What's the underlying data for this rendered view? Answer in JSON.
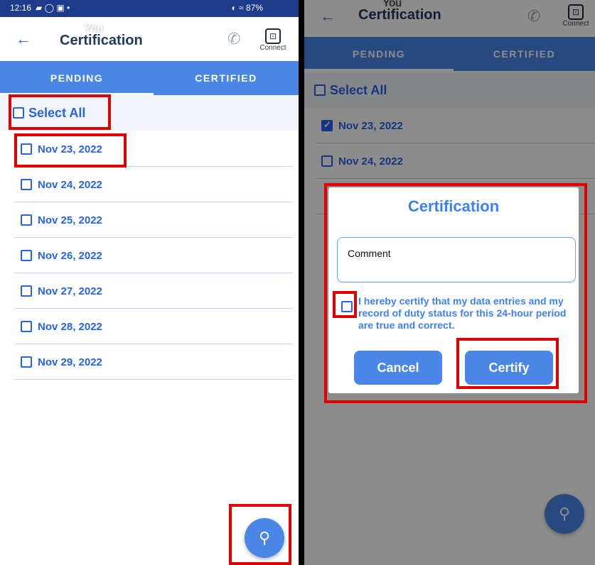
{
  "left_screen": {
    "status_bar": {
      "time": "12:16",
      "icons": "▰ ◯ ▣ •",
      "right": "◐ ≈ 87%"
    },
    "header": {
      "back": "←",
      "title": "Certification",
      "you": "You",
      "phone_icon": "✆",
      "connect_glyph": "⊡",
      "connect_label": "Connect"
    },
    "tabs": [
      {
        "label": "PENDING"
      },
      {
        "label": "CERTIFIED"
      }
    ],
    "select_all": "Select All",
    "dates": [
      {
        "label": "Nov 23, 2022"
      },
      {
        "label": "Nov 24, 2022"
      },
      {
        "label": "Nov 25, 2022"
      },
      {
        "label": "Nov 26, 2022"
      },
      {
        "label": "Nov 27, 2022"
      },
      {
        "label": "Nov 28, 2022"
      },
      {
        "label": "Nov 29, 2022"
      }
    ],
    "fab_icon": "⚲"
  },
  "right_screen": {
    "header": {
      "back": "←",
      "title": "Certification",
      "you": "You",
      "phone_icon": "✆",
      "connect_glyph": "⊡",
      "connect_label": "Connect"
    },
    "tabs": [
      {
        "label": "PENDING"
      },
      {
        "label": "CERTIFIED"
      }
    ],
    "select_all": "Select All",
    "dates": [
      {
        "label": "Nov 23, 2022",
        "checked": true
      },
      {
        "label": "Nov 24, 2022",
        "checked": false
      }
    ],
    "dialog": {
      "title": "Certification",
      "comment_placeholder": "Comment",
      "certify_statement": "I hereby certify that my data entries and my record of duty status for this 24-hour period are true and correct.",
      "cancel_label": "Cancel",
      "certify_label": "Certify"
    },
    "fab_icon": "⚲"
  },
  "colors": {
    "accent": "#4a86e8",
    "link_blue": "#2563eb",
    "highlight": "#e00000"
  }
}
